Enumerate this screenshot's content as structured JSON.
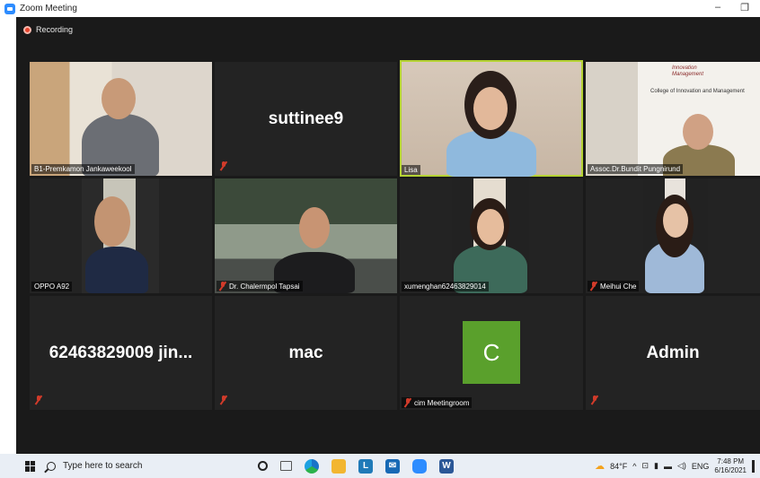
{
  "window": {
    "title": "Zoom Meeting",
    "minimize": "–",
    "restore": "❐"
  },
  "recording": {
    "label": "Recording"
  },
  "tiles": {
    "t1": {
      "name": "B1-Premkamon Jankaweekool"
    },
    "t2": {
      "name": "suttinee9"
    },
    "t3": {
      "name": "Lisa"
    },
    "t4": {
      "name": "Assoc.Dr.Bundit Pungnirund",
      "logo_line1": "Innovation",
      "logo_line2": "Management",
      "sign": "College of Innovation and Management"
    },
    "t5": {
      "name": "OPPO A92"
    },
    "t6": {
      "name": "Dr. Chalermpol Tapsai"
    },
    "t7": {
      "name": "xumenghan62463829014"
    },
    "t8": {
      "name": "Meihui Che"
    },
    "t9": {
      "name": "62463829009  jin..."
    },
    "t10": {
      "name": "mac"
    },
    "t11": {
      "name": "cim Meetingroom",
      "avatar_letter": "C"
    },
    "t12": {
      "name": "Admin"
    }
  },
  "colors": {
    "active_speaker_border": "#b5d334",
    "mute_red": "#d23b2a",
    "avatar_green": "#5aa02c",
    "recording_red": "#e8442d"
  },
  "taskbar": {
    "search_placeholder": "Type here to search",
    "weather": "84°F",
    "language": "ENG",
    "time": "7:48 PM",
    "date": "6/16/2021",
    "word_letter": "W",
    "l_letter": "L"
  }
}
